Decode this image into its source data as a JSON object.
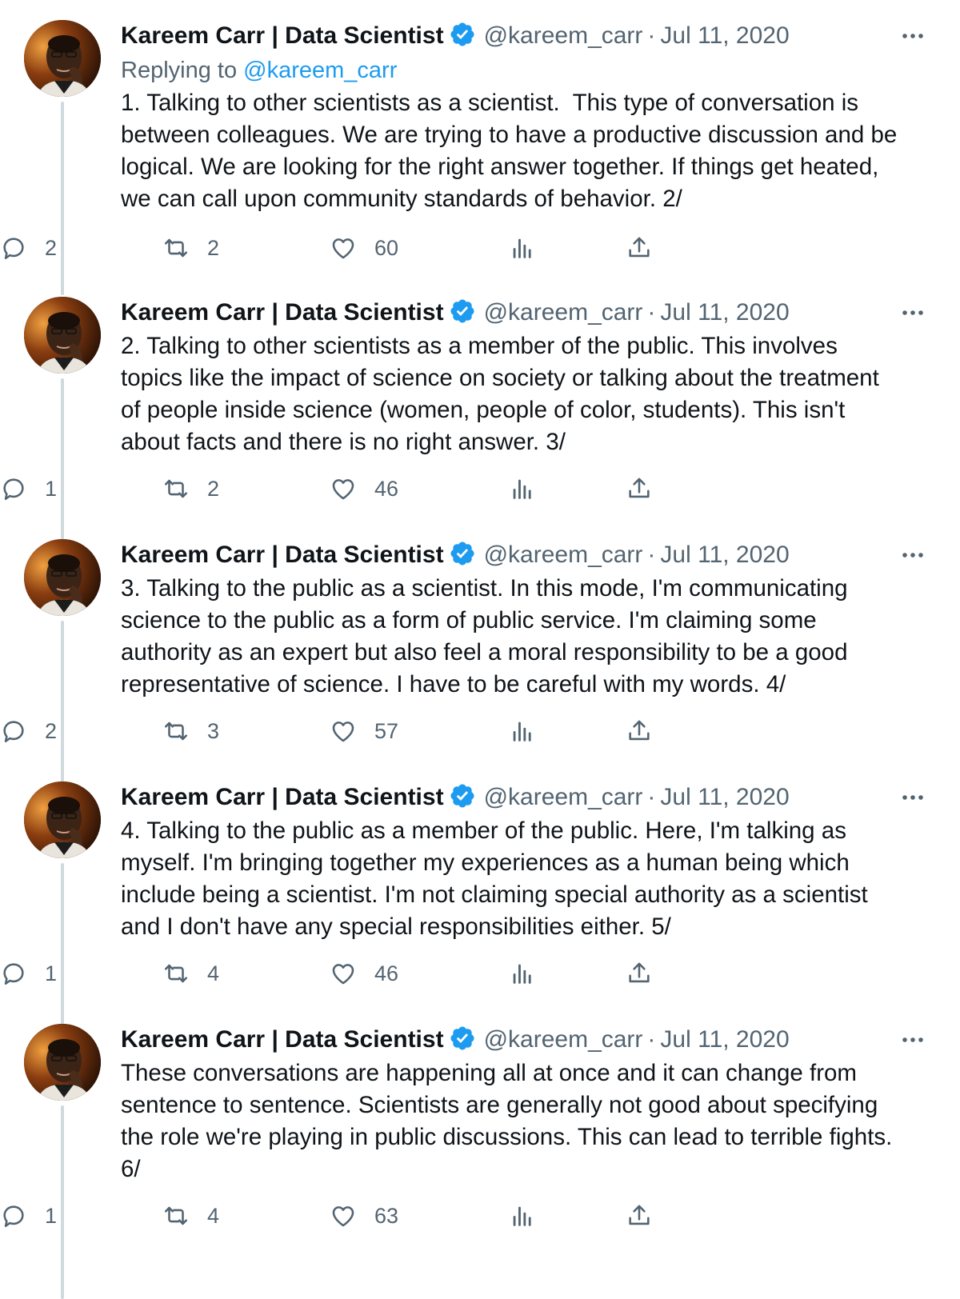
{
  "tweets": [
    {
      "name": "Kareem Carr | Data Scientist",
      "handle": "@kareem_carr",
      "separator": "·",
      "date": "Jul 11, 2020",
      "replying_label": "Replying to",
      "replying_to": "@kareem_carr",
      "text": "1. Talking to other scientists as a scientist.  This type of conversation is\nbetween colleagues. We are trying to have a productive discussion and be\nlogical. We are looking for the right answer together. If things get heated,\nwe can call upon community standards of behavior. 2/",
      "replies": "2",
      "retweets": "2",
      "likes": "60"
    },
    {
      "name": "Kareem Carr | Data Scientist",
      "handle": "@kareem_carr",
      "separator": "·",
      "date": "Jul 11, 2020",
      "text": "2. Talking to other scientists as a member of the public. This involves\ntopics like the impact of science on society or talking about the treatment\nof people inside science (women, people of color, students). This isn't\nabout facts and there is no right answer. 3/",
      "replies": "1",
      "retweets": "2",
      "likes": "46"
    },
    {
      "name": "Kareem Carr | Data Scientist",
      "handle": "@kareem_carr",
      "separator": "·",
      "date": "Jul 11, 2020",
      "text": "3. Talking to the public as a scientist. In this mode, I'm communicating\nscience to the public as a form of public service. I'm claiming some\nauthority as an expert but also feel a moral responsibility to be a good\nrepresentative of science. I have to be careful with my words. 4/",
      "replies": "2",
      "retweets": "3",
      "likes": "57"
    },
    {
      "name": "Kareem Carr | Data Scientist",
      "handle": "@kareem_carr",
      "separator": "·",
      "date": "Jul 11, 2020",
      "text": "4. Talking to the public as a member of the public. Here, I'm talking as\nmyself. I'm bringing together my experiences as a human being which\ninclude being a scientist. I'm not claiming special authority as a scientist\nand I don't have any special responsibilities either. 5/",
      "replies": "1",
      "retweets": "4",
      "likes": "46"
    },
    {
      "name": "Kareem Carr | Data Scientist",
      "handle": "@kareem_carr",
      "separator": "·",
      "date": "Jul 11, 2020",
      "text": "These conversations are happening all at once and it can change from\nsentence to sentence. Scientists are generally not good about specifying\nthe role we're playing in public discussions. This can lead to terrible fights.\n6/",
      "replies": "1",
      "retweets": "4",
      "likes": "63"
    }
  ],
  "icons": {
    "verified": "verified-badge-icon",
    "more": "more-options-icon",
    "reply": "reply-icon",
    "retweet": "retweet-icon",
    "like": "like-icon",
    "views": "views-icon",
    "share": "share-icon"
  },
  "colors": {
    "verified": "#1d9bf0",
    "mention": "#1d9bf0",
    "secondary_text": "#536471",
    "thread_line": "#cfd9de"
  }
}
